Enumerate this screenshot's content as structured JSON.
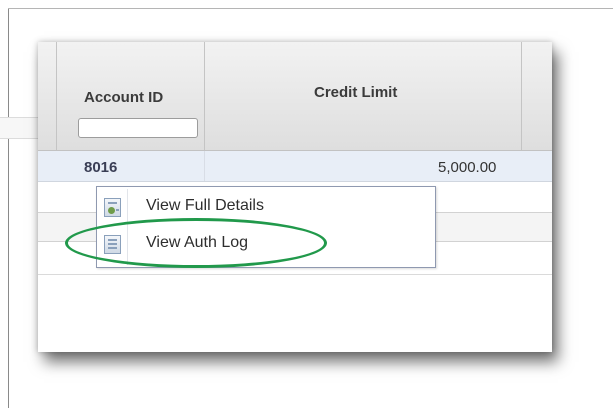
{
  "grid": {
    "columns": [
      {
        "label": "Account ID"
      },
      {
        "label": "Credit Limit"
      }
    ],
    "filter": {
      "value": "",
      "placeholder": ""
    },
    "rows": [
      {
        "account_id": "8016",
        "credit_limit": "5,000.00",
        "selected": true
      }
    ]
  },
  "context_menu": {
    "items": [
      {
        "label": "View Full Details",
        "icon": "user-details-icon"
      },
      {
        "label": "View Auth Log",
        "icon": "log-document-icon",
        "highlighted": true
      }
    ]
  },
  "colors": {
    "highlight": "#21994b",
    "selected_row": "#e8eef7",
    "header_bg": "#e6e6e6"
  }
}
